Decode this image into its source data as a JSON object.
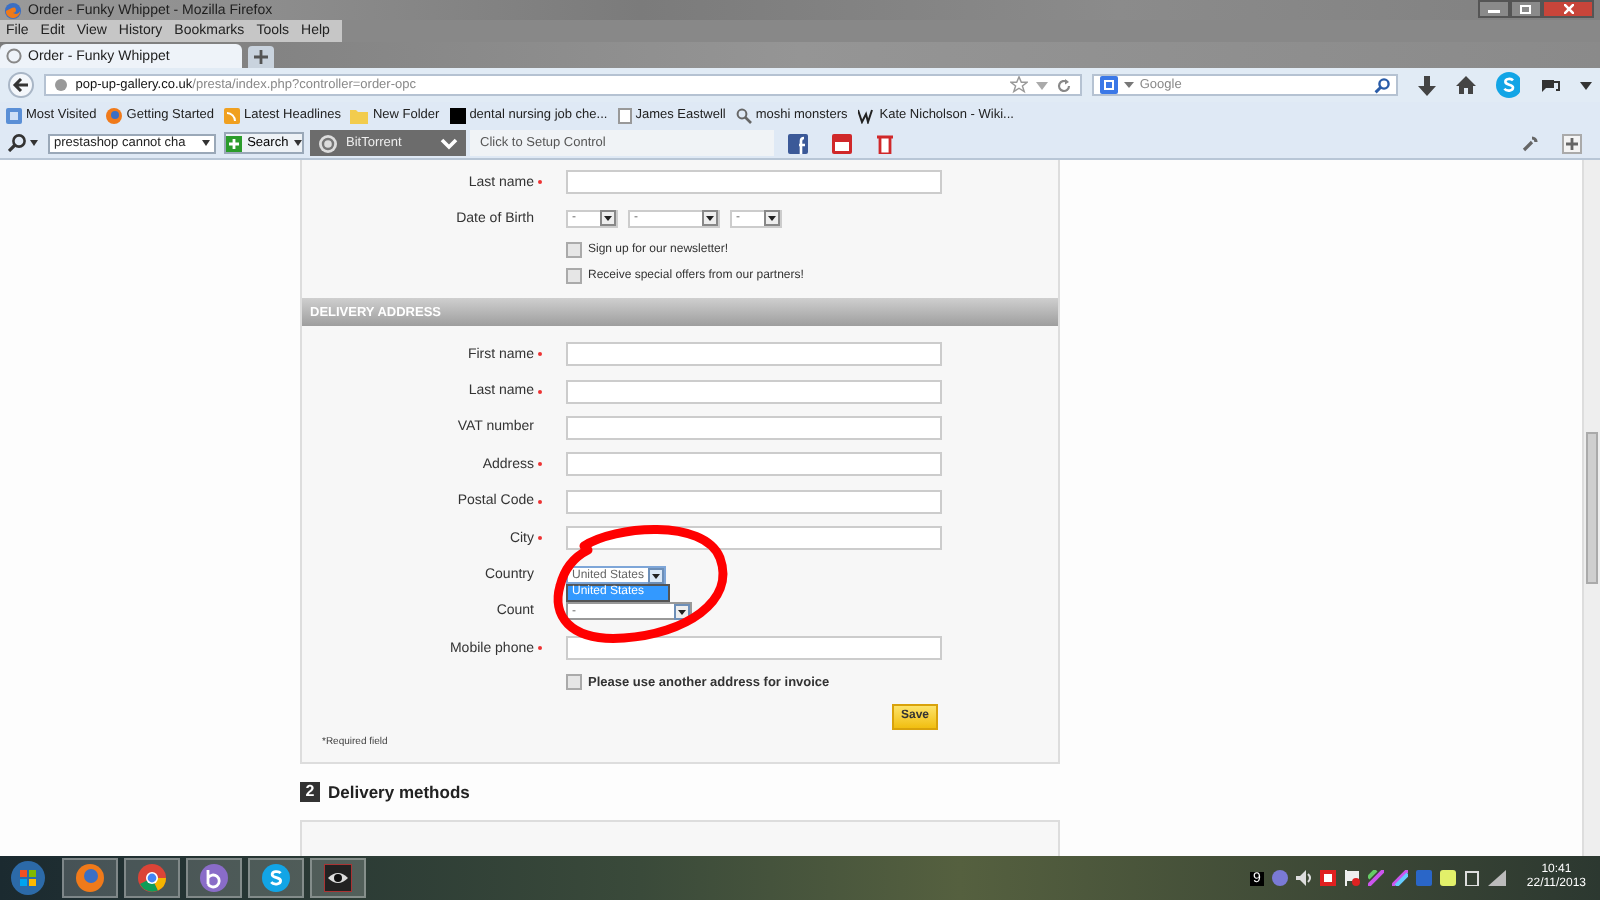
{
  "window": {
    "title": "Order - Funky Whippet - Mozilla Firefox"
  },
  "menu": [
    "File",
    "Edit",
    "View",
    "History",
    "Bookmarks",
    "Tools",
    "Help"
  ],
  "tabs": [
    {
      "label": "Order - Funky Whippet",
      "selected": true
    }
  ],
  "address_bar": {
    "domain": "pop-up-gallery.co.uk",
    "path": "/presta/index.php?controller=order-opc"
  },
  "search_bar": {
    "placeholder": "Google"
  },
  "bookmarks": [
    {
      "label": "Most Visited",
      "kind": "smart"
    },
    {
      "label": "Getting Started",
      "kind": "firefox"
    },
    {
      "label": "Latest Headlines",
      "kind": "feed"
    },
    {
      "label": "New Folder",
      "kind": "folder"
    },
    {
      "label": "dental nursing job che...",
      "kind": "black"
    },
    {
      "label": "James Eastwell",
      "kind": "blank"
    },
    {
      "label": "moshi monsters",
      "kind": "search"
    },
    {
      "label": "Kate Nicholson - Wiki...",
      "kind": "wiki"
    }
  ],
  "addon_bar": {
    "search_value": "prestashop cannot cha",
    "search_button": "Search",
    "toolbar_name": "BitTorrent",
    "setup_link": "Click to Setup Control"
  },
  "form": {
    "personal_fields": [
      {
        "label": "Last name",
        "required": true,
        "kind": "text"
      },
      {
        "label": "Date of Birth",
        "required": false,
        "kind": "date",
        "selects": [
          "-",
          "-",
          "-"
        ]
      }
    ],
    "options": [
      {
        "label": "Sign up for our newsletter!",
        "checked": false
      },
      {
        "label": "Receive special offers from our partners!",
        "checked": false
      }
    ],
    "section_title": "DELIVERY ADDRESS",
    "delivery_fields": [
      {
        "label": "First name",
        "required": true,
        "kind": "text"
      },
      {
        "label": "Last name",
        "required": true,
        "kind": "text"
      },
      {
        "label": "VAT number",
        "required": false,
        "kind": "text"
      },
      {
        "label": "Address",
        "required": true,
        "kind": "text"
      },
      {
        "label": "Postal Code",
        "required": true,
        "kind": "text"
      },
      {
        "label": "City",
        "required": true,
        "kind": "text"
      },
      {
        "label": "Country",
        "required": false,
        "kind": "select",
        "value": "United States",
        "open": true,
        "options": [
          {
            "label": "United States",
            "selected": true
          }
        ]
      },
      {
        "label": "Count",
        "required": false,
        "kind": "select",
        "value": "-",
        "open": false
      },
      {
        "label": "Mobile phone",
        "required": true,
        "kind": "text"
      }
    ],
    "invoice_option": {
      "label": "Please use another address for invoice",
      "checked": false
    },
    "save_button": "Save",
    "required_note": "*Required field"
  },
  "next_step": {
    "number": "2",
    "title": "Delivery methods"
  },
  "taskbar": {
    "tray_badge": "9",
    "clock_time": "10:41",
    "clock_date": "22/11/2013"
  }
}
